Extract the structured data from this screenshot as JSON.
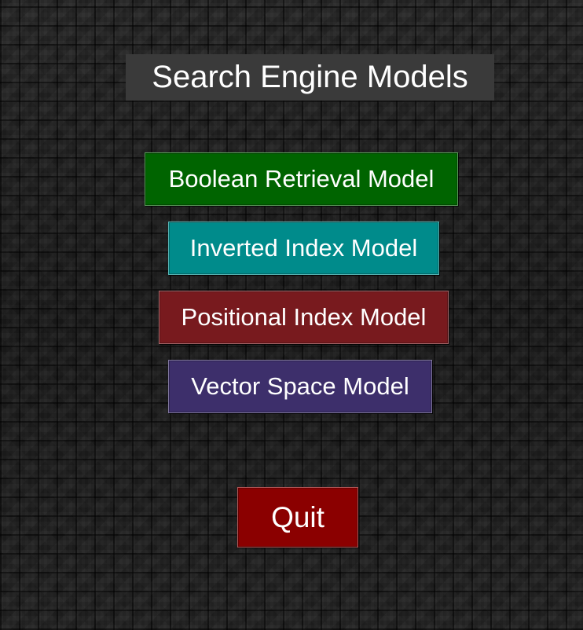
{
  "window": {
    "title": "Search Engine Models"
  },
  "menu": {
    "buttons": [
      {
        "label": "Boolean Retrieval Model",
        "color": "#006400"
      },
      {
        "label": "Inverted Index Model",
        "color": "#008b8b"
      },
      {
        "label": "Positional Index Model",
        "color": "#781a1e"
      },
      {
        "label": "Vector Space Model",
        "color": "#3d2f6b"
      }
    ],
    "quit": {
      "label": "Quit",
      "color": "#8b0000"
    }
  },
  "theme": {
    "background": "#1c1c1c",
    "title_background": "#3a3a3a",
    "text_color": "#ffffff"
  }
}
